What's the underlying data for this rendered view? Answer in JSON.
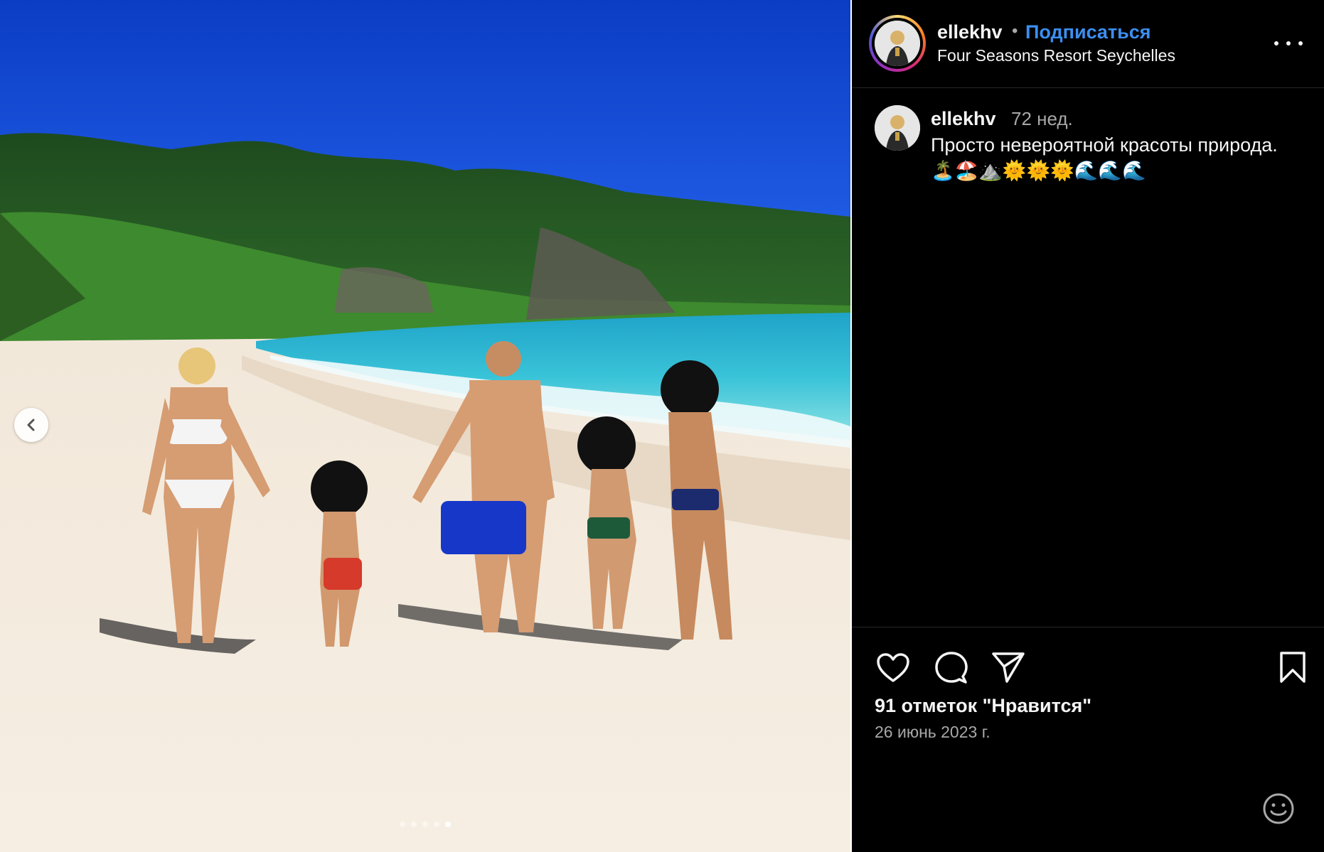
{
  "post": {
    "username": "ellekhv",
    "separator": "•",
    "follow_label": "Подписаться",
    "location": "Four Seasons Resort Seychelles"
  },
  "caption": {
    "username": "ellekhv",
    "time": "72 нед.",
    "text": "Просто невероятной красоты природа. 🏝️🏖️⛰️🌞🌞🌞🌊🌊🌊"
  },
  "stats": {
    "likes": "91 отметок \"Нравится\"",
    "date": "26 июнь 2023 г."
  },
  "carousel": {
    "total": 5,
    "active_index": 4
  },
  "icons": {
    "prev": "chevron-left-icon",
    "more": "more-horizontal-icon",
    "like": "heart-icon",
    "comment": "comment-icon",
    "share": "send-icon",
    "save": "bookmark-icon",
    "emoji": "smiley-icon"
  },
  "colors": {
    "panel_bg": "#000000",
    "link_blue": "#3b8ff0",
    "muted": "#a8a8a8",
    "divider": "#262626"
  }
}
